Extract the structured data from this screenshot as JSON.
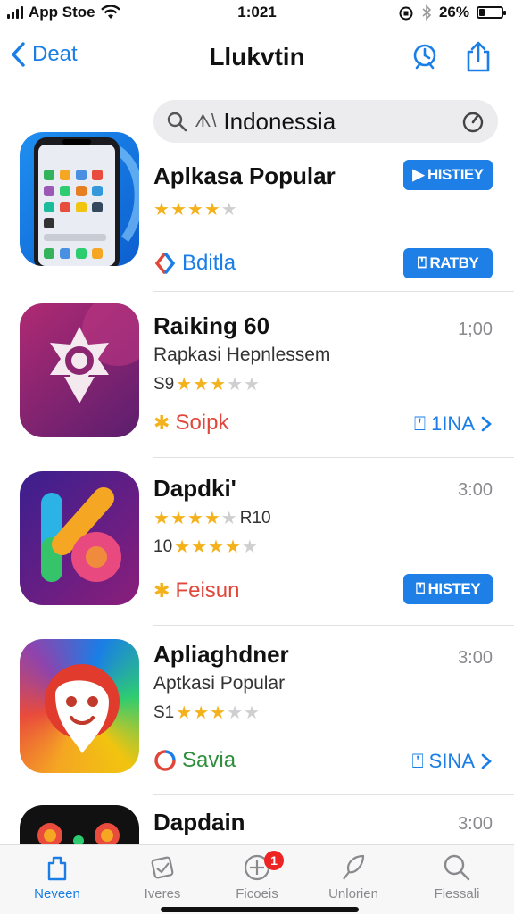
{
  "status_bar": {
    "carrier": "App Stoe",
    "time": "1:021",
    "battery": "26%",
    "battery_level": 0.26
  },
  "nav": {
    "back_label": "Deat",
    "title": "Llukvtin"
  },
  "search": {
    "prefix": "ᗑ\\",
    "value": "Indonessia"
  },
  "apps": [
    {
      "name": "Aplkasa Popular",
      "rating_prefix": "",
      "stars_filled": 4,
      "rating_suffix": "",
      "developer": "Bditla",
      "developer_color": "#1a7ee6",
      "top_button": "HISTIEY",
      "bottom_button": "RATBY"
    },
    {
      "name": "Raiking 60",
      "subtitle": "Rapkasi Hepnlessem",
      "rating_prefix": "S9",
      "stars_filled": 3,
      "rating_suffix": "",
      "developer": "Soipk",
      "developer_color": "#e0463a",
      "time": "1;00",
      "link": "1INA"
    },
    {
      "name": "Dapdki'",
      "rating_prefix": "",
      "stars_filled": 4,
      "rating_suffix": "R10",
      "rating2_prefix": "10",
      "stars2_filled": 4,
      "developer": "Feisun",
      "developer_color": "#e0463a",
      "time": "3:00",
      "bottom_button": "HISTEY"
    },
    {
      "name": "Apliaghdner",
      "subtitle": "Aptkasi Popular",
      "rating_prefix": "S1",
      "stars_filled": 3,
      "rating_suffix": "",
      "developer": "Savia",
      "developer_color": "#2f8f3c",
      "time": "3:00",
      "link": "SINA"
    },
    {
      "name": "Dapdain",
      "time": "3:00"
    }
  ],
  "tabs": [
    {
      "label": "Neveen",
      "icon": "today-icon",
      "active": true
    },
    {
      "label": "Iveres",
      "icon": "games-icon"
    },
    {
      "label": "Ficoeis",
      "icon": "apps-icon",
      "badge": "1"
    },
    {
      "label": "Unlorien",
      "icon": "updates-icon"
    },
    {
      "label": "Fiessali",
      "icon": "search-icon"
    }
  ],
  "colors": {
    "accent": "#1a7ee6",
    "button": "#1e7fe6",
    "star": "#f3b21b",
    "badge": "#ee2424"
  }
}
